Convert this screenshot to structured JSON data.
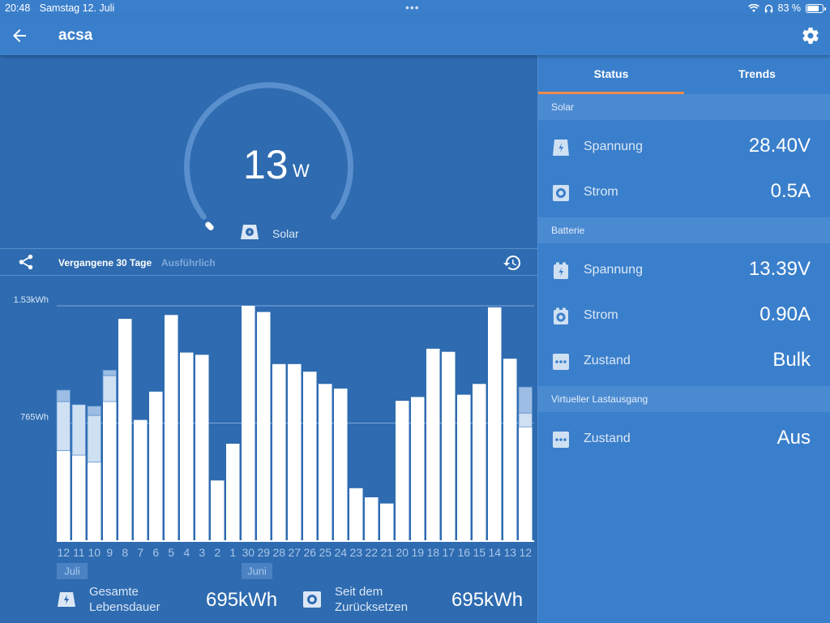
{
  "status_bar": {
    "time": "20:48",
    "date": "Samstag 12. Juli",
    "battery": "83 %",
    "battery_level": 0.83
  },
  "header": {
    "title": "acsa",
    "back_icon": "arrow-left-icon",
    "settings_icon": "gear-icon"
  },
  "gauge": {
    "value": "13",
    "unit": "W",
    "label": "Solar",
    "level": 0.01
  },
  "toolbar": {
    "range_label": "Vergangene 30 Tage",
    "detail_label": "Ausführlich"
  },
  "chart_data": {
    "type": "bar",
    "y_ticks": [
      "1.53kWh",
      "765Wh"
    ],
    "ylim": [
      0,
      1530
    ],
    "grid": true,
    "categories": [
      "12",
      "11",
      "10",
      "9",
      "8",
      "7",
      "6",
      "5",
      "4",
      "3",
      "2",
      "1",
      "30",
      "29",
      "28",
      "27",
      "26",
      "25",
      "24",
      "23",
      "22",
      "21",
      "20",
      "19",
      "18",
      "17",
      "16",
      "15",
      "14",
      "13",
      "12"
    ],
    "month_labels": [
      "Juli",
      "Juni"
    ],
    "series": [
      {
        "values": [
          585,
          555,
          510,
          905,
          1445,
          785,
          970,
          1470,
          1225,
          1210,
          390,
          630,
          1530,
          1490,
          1150,
          1150,
          1100,
          1020,
          990,
          340,
          280,
          240,
          910,
          935,
          1250,
          1230,
          950,
          1020,
          1520,
          1185,
          740
        ]
      },
      {
        "values": [
          320,
          330,
          305,
          170,
          0,
          0,
          0,
          0,
          0,
          0,
          0,
          0,
          0,
          0,
          0,
          0,
          0,
          0,
          0,
          0,
          0,
          0,
          0,
          0,
          0,
          0,
          0,
          0,
          0,
          0,
          90
        ]
      },
      {
        "values": [
          75,
          0,
          60,
          35,
          0,
          0,
          0,
          0,
          0,
          0,
          0,
          0,
          0,
          0,
          0,
          0,
          0,
          0,
          0,
          0,
          0,
          0,
          0,
          0,
          0,
          0,
          0,
          0,
          0,
          0,
          170
        ]
      }
    ],
    "colors": [
      "#ffffff",
      "#cfe0f3",
      "#9dbde4"
    ]
  },
  "totals": {
    "lifetime_label_1": "Gesamte",
    "lifetime_label_2": "Lebensdauer",
    "lifetime_value": "695kWh",
    "reset_label_1": "Seit dem",
    "reset_label_2": "Zurücksetzen",
    "reset_value": "695kWh"
  },
  "tabs": {
    "status": "Status",
    "trends": "Trends"
  },
  "panel": {
    "solar_header": "Solar",
    "solar_voltage_label": "Spannung",
    "solar_voltage_value": "28.40V",
    "solar_current_label": "Strom",
    "solar_current_value": "0.5A",
    "battery_header": "Batterie",
    "battery_voltage_label": "Spannung",
    "battery_voltage_value": "13.39V",
    "battery_current_label": "Strom",
    "battery_current_value": "0.90A",
    "battery_state_label": "Zustand",
    "battery_state_value": "Bulk",
    "load_header": "Virtueller Lastausgang",
    "load_state_label": "Zustand",
    "load_state_value": "Aus"
  }
}
